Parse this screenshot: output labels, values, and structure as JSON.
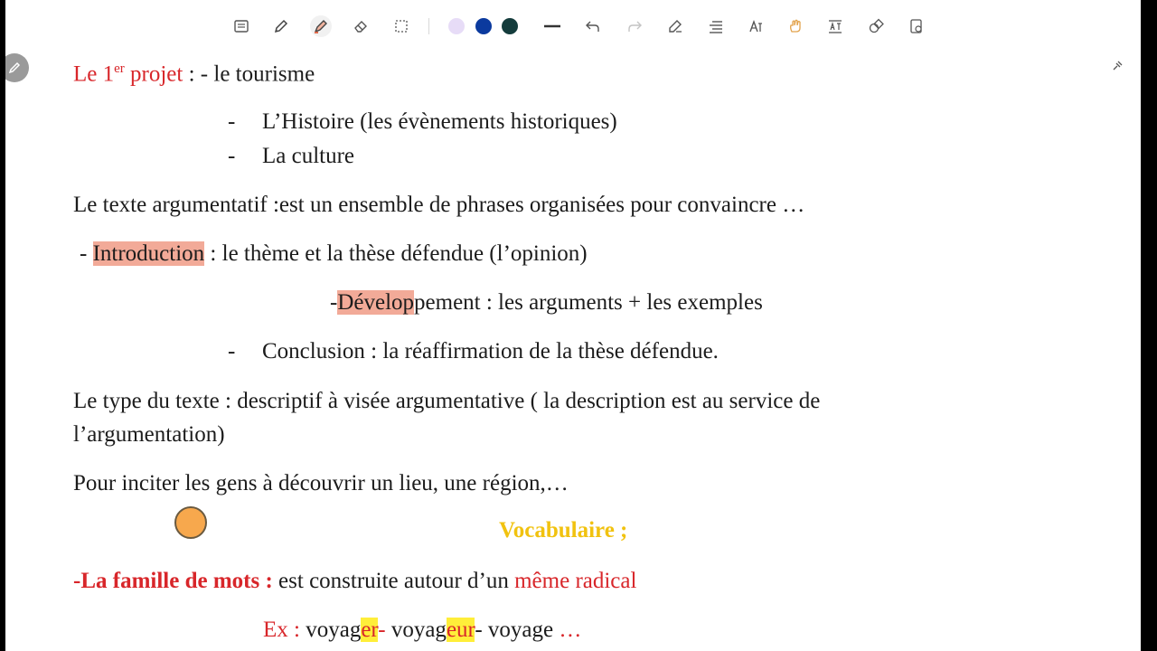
{
  "colors": {
    "accent_red": "#d8262a",
    "highlight_pink": "#f2aa98",
    "highlight_yellow": "#ffee3a",
    "vocab_gold": "#f1c20f",
    "pointer_orange": "#f7a84d"
  },
  "toolbar": {
    "tools": [
      {
        "name": "text-icon"
      },
      {
        "name": "pen-icon"
      },
      {
        "name": "highlighter-icon"
      },
      {
        "name": "eraser-icon"
      },
      {
        "name": "lasso-select-icon"
      }
    ],
    "swatches": [
      "#e7dcf7",
      "#0b3a9e",
      "#143c3c"
    ],
    "actions": [
      {
        "name": "stroke-width-icon"
      },
      {
        "name": "undo-icon"
      },
      {
        "name": "redo-icon"
      },
      {
        "name": "shape-pen-icon"
      },
      {
        "name": "align-icon"
      },
      {
        "name": "text-style-icon"
      },
      {
        "name": "hand-icon"
      },
      {
        "name": "text-box-icon"
      },
      {
        "name": "shapes-icon"
      },
      {
        "name": "export-icon"
      }
    ]
  },
  "doc": {
    "l1": {
      "a": "Le 1",
      "sup": "er",
      "b": " projet",
      "c": " : - le tourisme"
    },
    "l2": {
      "dash": "-",
      "text": "L’Histoire (les évènements historiques)"
    },
    "l3": {
      "dash": "-",
      "text": "La culture"
    },
    "l4": "Le texte argumentatif :est un ensemble de phrases organisées pour convaincre …",
    "l5": {
      "dash": "- ",
      "hl": "Introduction",
      "rest": " : le thème et la thèse défendue (l’opinion)"
    },
    "l6": {
      "dash": "-",
      "hl": "Dévelop",
      "rest": "pement : les arguments + les exemples"
    },
    "l7": {
      "dash": "-",
      "text": "Conclusion : la réaffirmation de la thèse défendue."
    },
    "l8": "Le type du texte : descriptif à visée argumentative ( la description est au service de",
    "l9": "l’argumentation)",
    "l10": "Pour inciter les gens à découvrir un lieu, une région,…",
    "vocab": "Vocabulaire ;",
    "l11": {
      "bold": "-La famille de mots :",
      "mid": " est construite autour d’un ",
      "red": "même radical"
    },
    "l12": {
      "ex": "Ex : ",
      "w1": "voyag",
      "w1hl": "er",
      "s1": "- ",
      "w2": "voyag",
      "w2hl": "eur",
      "s2": "- voyage ",
      "dots": "…"
    }
  }
}
